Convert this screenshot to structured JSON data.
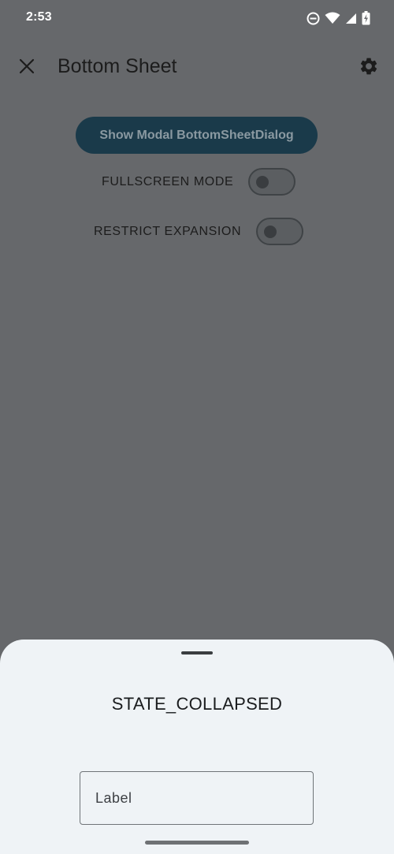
{
  "status_bar": {
    "time": "2:53",
    "icons": [
      "do-not-disturb-icon",
      "wifi-icon",
      "cell-signal-icon",
      "battery-charging-icon"
    ]
  },
  "app_bar": {
    "title": "Bottom Sheet",
    "close_icon": "close-icon",
    "settings_icon": "gear-icon"
  },
  "main": {
    "modal_button_label": "Show Modal BottomSheetDialog",
    "toggles": [
      {
        "label": "FULLSCREEN MODE",
        "checked": false
      },
      {
        "label": "RESTRICT EXPANSION",
        "checked": false
      }
    ]
  },
  "sheet": {
    "state": "STATE_COLLAPSED",
    "text_field": {
      "placeholder": "Label",
      "value": ""
    }
  },
  "colors": {
    "scrim": "#66686b",
    "sheet_background": "#eff3f6",
    "button_background": "#1a3a4a",
    "button_text": "#8a99a1"
  }
}
